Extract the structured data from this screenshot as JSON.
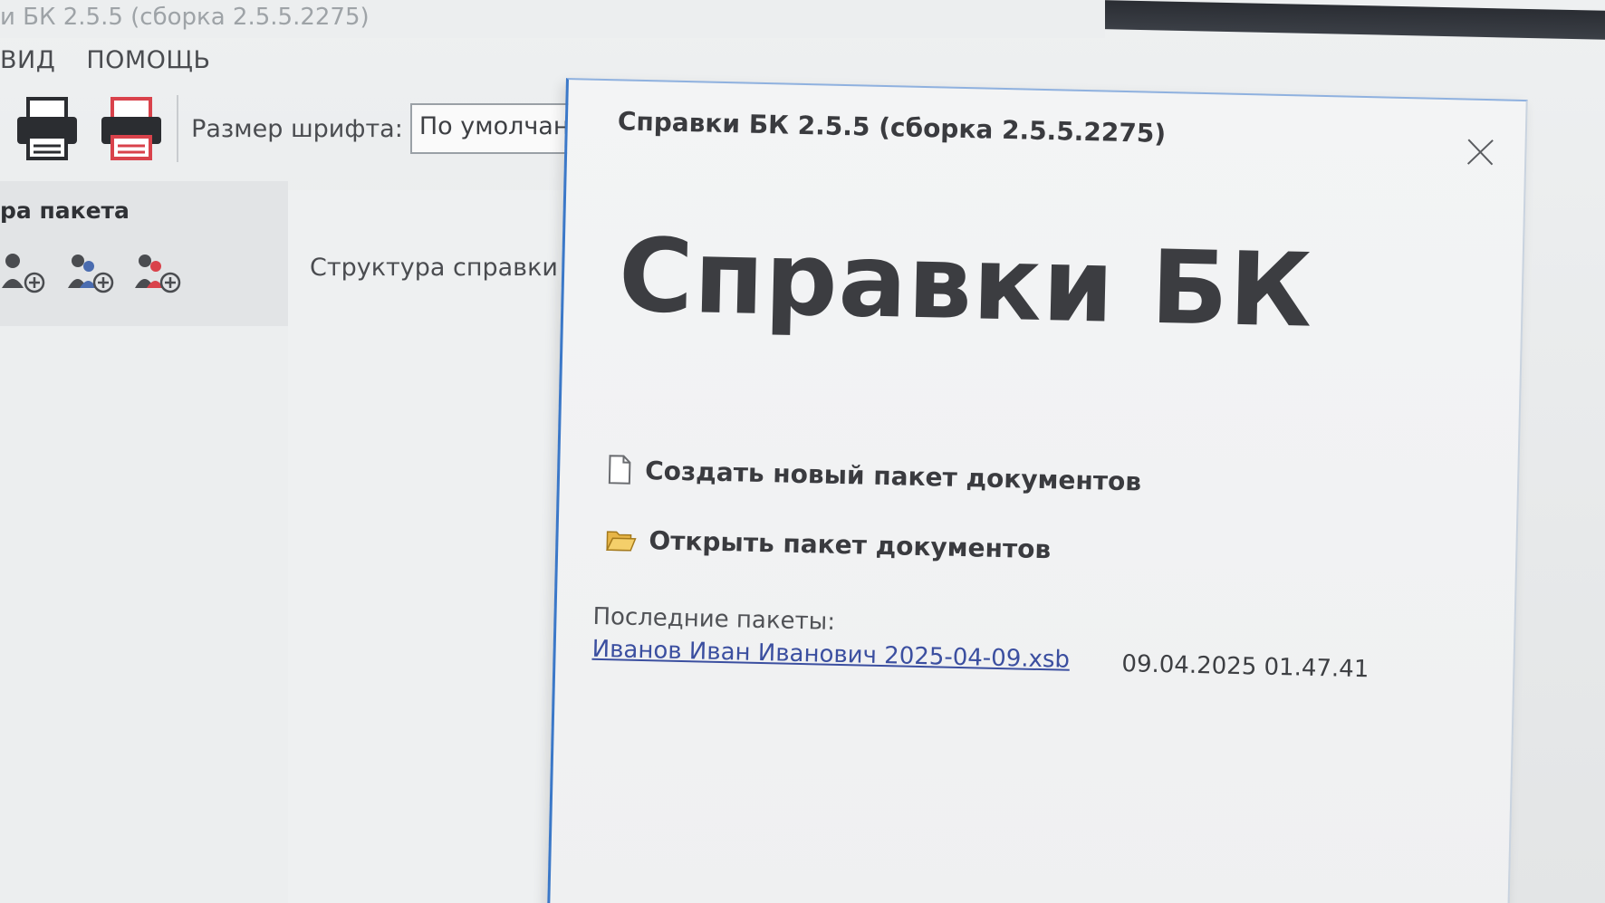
{
  "window": {
    "title": "и БК 2.5.5 (сборка 2.5.5.2275)"
  },
  "menu": {
    "items": [
      {
        "label": "ВИД"
      },
      {
        "label": "ПОМОЩЬ"
      }
    ]
  },
  "toolbar": {
    "font_size_label": "Размер шрифта:",
    "font_size_value": "По умолчанию"
  },
  "left_panel": {
    "heading": "ра пакета",
    "icons": [
      "add-person-icon",
      "add-persons-icon",
      "add-person-red-icon"
    ]
  },
  "mid_panel": {
    "title": "Структура справки"
  },
  "dialog": {
    "title": "Справки БК 2.5.5 (сборка 2.5.5.2275)",
    "heading": "Справки БК",
    "actions": {
      "new_package": "Создать новый пакет документов",
      "open_package": "Открыть пакет документов"
    },
    "recent_label": "Последние пакеты:",
    "recent": [
      {
        "name": "Иванов Иван Иванович 2025-04-09.xsb",
        "date": "09.04.2025 01.47.41"
      }
    ]
  },
  "colors": {
    "accent": "#3b78c8",
    "link": "#3b4fa0",
    "printer_red": "#d9424b"
  }
}
